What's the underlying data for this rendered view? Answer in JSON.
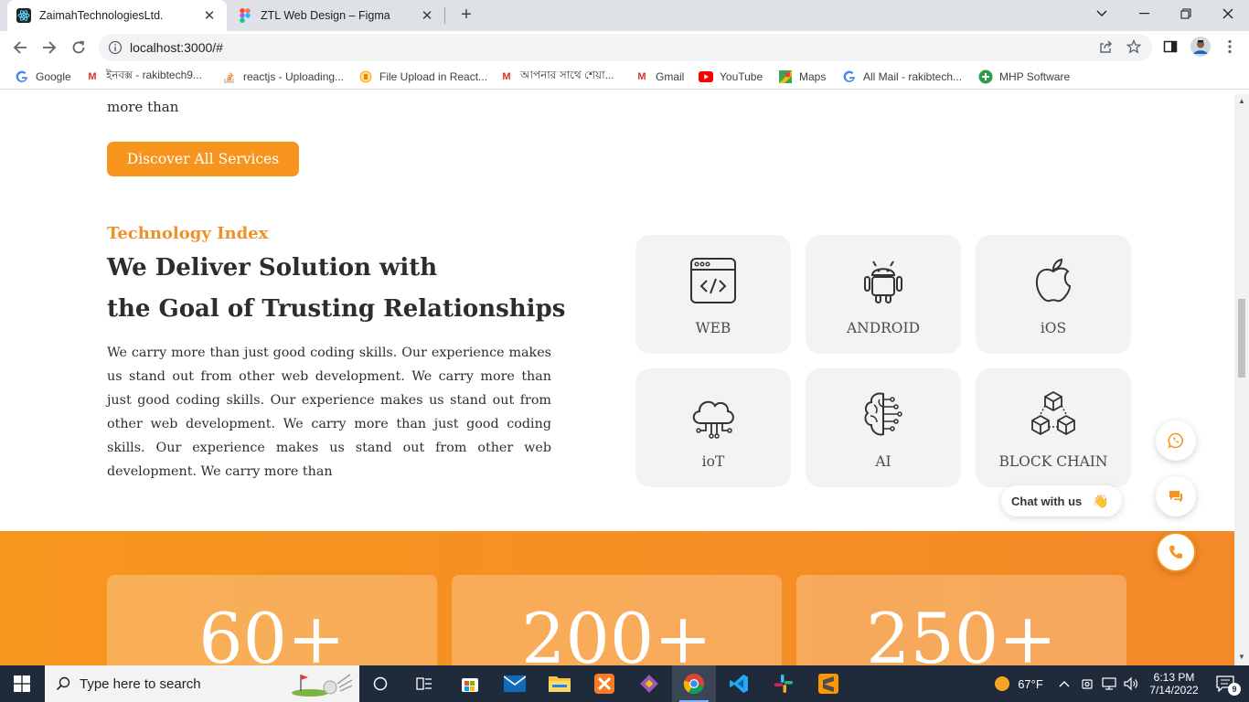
{
  "browser": {
    "tabs": [
      {
        "title": "ZaimahTechnologiesLtd.",
        "active": true,
        "icon": "react-icon"
      },
      {
        "title": "ZTL Web Design – Figma",
        "active": false,
        "icon": "figma-icon"
      }
    ],
    "url": "localhost:3000/#",
    "bookmarks": [
      {
        "label": "Google",
        "icon": "google-icon"
      },
      {
        "label": "ইনবক্স - rakibtech9...",
        "icon": "gmail-icon"
      },
      {
        "label": "reactjs - Uploading...",
        "icon": "stackoverflow-icon"
      },
      {
        "label": "File Upload in React...",
        "icon": "bookmark-site-icon"
      },
      {
        "label": "আপনার সাথে শেয়া...",
        "icon": "gmail-icon"
      },
      {
        "label": "Gmail",
        "icon": "gmail-icon"
      },
      {
        "label": "YouTube",
        "icon": "youtube-icon"
      },
      {
        "label": "Maps",
        "icon": "maps-icon"
      },
      {
        "label": "All Mail - rakibtech...",
        "icon": "google-icon"
      },
      {
        "label": "MHP Software",
        "icon": "plus-circle-icon"
      }
    ]
  },
  "page": {
    "previous_text": "more than",
    "cta_label": "Discover All Services",
    "section": {
      "eyebrow": "Technology Index",
      "heading_line1": "We Deliver Solution with",
      "heading_line2": "the Goal of Trusting Relationships",
      "paragraph": "We carry more than just good coding skills. Our experience makes us stand out from other web development. We carry more than just good coding skills. Our experience makes us stand out from other web development. We carry more than just good coding skills. Our experience makes us stand out from other web development. We carry more than"
    },
    "technologies": [
      {
        "label": "WEB",
        "icon": "web-code-icon"
      },
      {
        "label": "ANDROID",
        "icon": "android-icon"
      },
      {
        "label": "iOS",
        "icon": "apple-icon"
      },
      {
        "label": "ioT",
        "icon": "cloud-circuit-icon"
      },
      {
        "label": "AI",
        "icon": "brain-circuit-icon"
      },
      {
        "label": "BLOCK CHAIN",
        "icon": "blocks-icon"
      }
    ],
    "stats": [
      "60+",
      "200+",
      "250+"
    ],
    "chat_label": "Chat with us",
    "colors": {
      "accent": "#f7941d",
      "card_bg": "#f3f3f3"
    }
  },
  "taskbar": {
    "search_placeholder": "Type here to search",
    "weather": "67°F",
    "time": "6:13 PM",
    "date": "7/14/2022",
    "notification_count": "9"
  }
}
